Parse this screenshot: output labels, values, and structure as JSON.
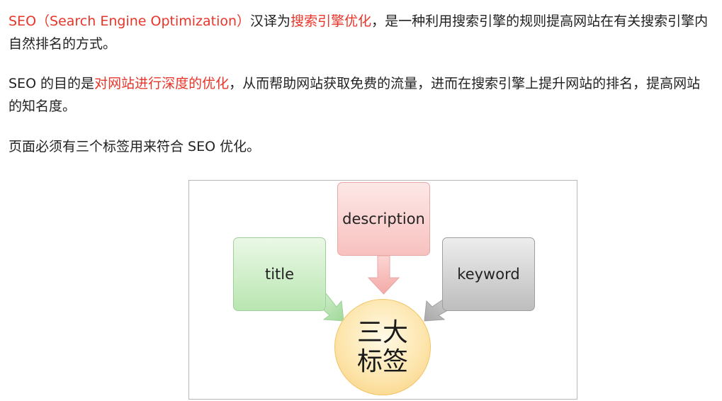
{
  "paragraphs": [
    {
      "seg1": "SEO（Search Engine Optimization）",
      "seg2": "汉译为",
      "seg3": "搜索引擎优化",
      "seg4": "，是一种利用搜索引擎的规则提高网站在有关搜索引擎内自然排名的方式。"
    },
    {
      "seg1": "SEO 的目的是",
      "seg2": "对网站进行深度的优化",
      "seg3": "，从而帮助网站获取免费的流量，进而在搜索引擎上提升网站的排名，提高网站的知名度。"
    },
    {
      "seg1": "页面必须有三个标签用来符合 SEO 优化。"
    }
  ],
  "diagram": {
    "boxes": {
      "description": "description",
      "title": "title",
      "keyword": "keyword"
    },
    "center": "三大标签",
    "colors": {
      "description": "#f7c1bf",
      "title": "#b9e6b1",
      "keyword": "#bdbdbd",
      "center": "#fde6ae",
      "highlight_text": "#e8352a"
    }
  }
}
